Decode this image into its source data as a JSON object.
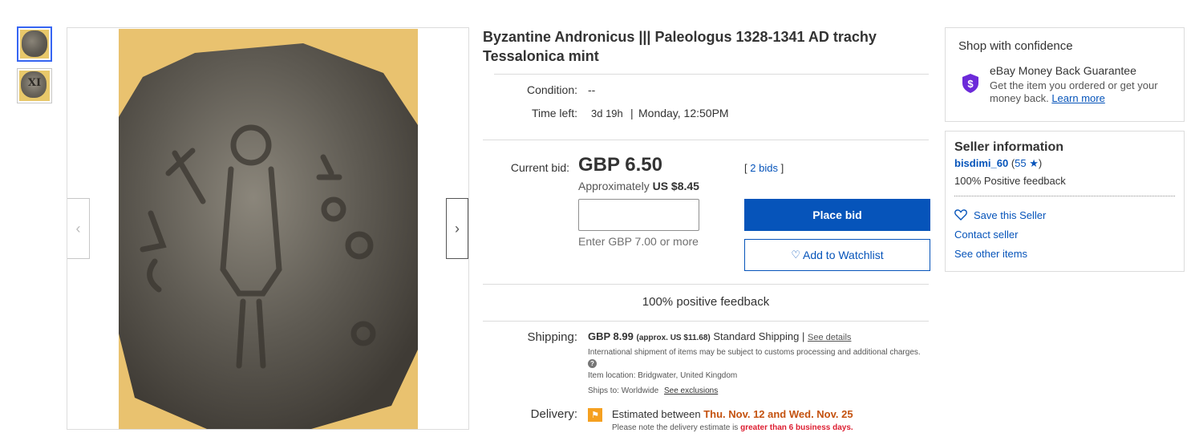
{
  "thumbnails": [
    {
      "glyph": ""
    },
    {
      "glyph": "XI"
    }
  ],
  "gallery": {
    "prev_icon": "chevron-left-icon",
    "next_icon": "chevron-right-icon",
    "prev_glyph": "‹",
    "next_glyph": "›"
  },
  "listing": {
    "title": "Byzantine Andronicus ||| Paleologus 1328-1341 AD trachy Tessalonica mint",
    "condition_label": "Condition:",
    "condition_value": "--",
    "time_left_label": "Time left:",
    "time_left_value": "3d 19h",
    "time_left_sep": "|",
    "end_time": "Monday, 12:50PM"
  },
  "bidding": {
    "current_bid_label": "Current bid:",
    "current_bid": "GBP 6.50",
    "approx_prefix": "Approximately",
    "approx_value": "US $8.45",
    "bids_open": "[",
    "bids_link": "2 bids",
    "bids_close": "]",
    "input_value": "",
    "enter_hint": "Enter GBP 7.00 or more",
    "place_bid": "Place bid",
    "watchlist": "Add to Watchlist",
    "watchlist_icon": "heart-icon"
  },
  "feedback_banner": "100% positive feedback",
  "shipping": {
    "label": "Shipping:",
    "cost": "GBP 8.99",
    "approx": "(approx. US $11.68)",
    "service": "Standard Shipping",
    "sep": "|",
    "details_link": "See details",
    "note": "International shipment of items may be subject to customs processing and additional charges.",
    "help_glyph": "?",
    "location_label": "Item location:",
    "location_value": "Bridgwater, United Kingdom",
    "ships_to_label": "Ships to:",
    "ships_to_value": "Worldwide",
    "exclusions_link": "See exclusions"
  },
  "delivery": {
    "label": "Delivery:",
    "flag_icon": "flag-icon",
    "estimated_prefix": "Estimated between",
    "range": "Thu. Nov. 12 and Wed. Nov. 25",
    "note_prefix": "Please note the delivery estimate is",
    "note_highlight": "greater than 6 business days."
  },
  "confidence": {
    "title": "Shop with confidence",
    "icon": "money-back-shield-icon",
    "icon_glyph": "$",
    "guarantee_title": "eBay Money Back Guarantee",
    "guarantee_text": "Get the item you ordered or get your money back.",
    "learn_more": "Learn more"
  },
  "seller": {
    "title": "Seller information",
    "name": "bisdimi_60",
    "score_open": "(",
    "score": "55",
    "star": "★",
    "score_close": ")",
    "feedback": "100% Positive feedback",
    "save": "Save this Seller",
    "contact": "Contact seller",
    "other_items": "See other items"
  },
  "colors": {
    "link": "#0654ba",
    "primary_button": "#0654ba",
    "delivery_highlight": "#c4520f",
    "warning": "#dd1e31",
    "shield": "#6c2ad9",
    "flag": "#f5a020"
  }
}
